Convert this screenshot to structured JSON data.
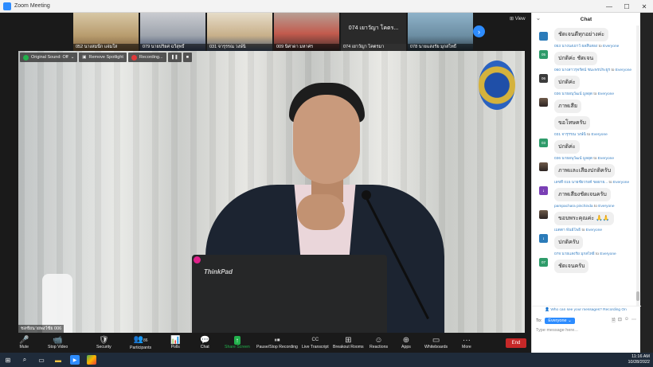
{
  "window": {
    "title": "Zoom Meeting",
    "controls": [
      "—",
      "☐",
      "✕"
    ]
  },
  "gallery": {
    "thumbnails": [
      {
        "name": "052 นางสมนึก แจ่มใส"
      },
      {
        "name": "079 นายปริยศ ฉวีสุทธิ์"
      },
      {
        "name": "031 จารุรรณ วงษ์นิ"
      },
      {
        "name": "009 นิศาดา มหาศร"
      },
      {
        "name": "074 เยาวัญา โคตรมา",
        "big_name": "074 เยาวัญา โคตร..."
      },
      {
        "name": "078 นายแสงรัย มุกสไทธิ์"
      }
    ],
    "view_label": "View"
  },
  "video_toolbar": {
    "original_sound": "Original Sound: Off",
    "remove_spotlight": "Remove Spotlight",
    "recording": "Recording..."
  },
  "main_video": {
    "speaker_label": "ชลชัยนายพงว์ชัย 006",
    "laptop_brand": "ThinkPad"
  },
  "controls": [
    {
      "id": "mute",
      "icon": "🎤",
      "label": "Mute"
    },
    {
      "id": "stop-video",
      "icon": "📹",
      "label": "Stop Video"
    },
    {
      "id": "security",
      "icon": "🛡",
      "label": "Security"
    },
    {
      "id": "participants",
      "icon": "👥",
      "label": "Participants",
      "count": "86"
    },
    {
      "id": "polls",
      "icon": "📊",
      "label": "Polls"
    },
    {
      "id": "chat",
      "icon": "💬",
      "label": "Chat"
    },
    {
      "id": "share-screen",
      "icon": "↑",
      "label": "Share Screen"
    },
    {
      "id": "pause-stop-recording",
      "icon": "⏸⏹",
      "label": "Pause/Stop Recording"
    },
    {
      "id": "live-transcript",
      "icon": "CC",
      "label": "Live Transcript"
    },
    {
      "id": "breakout-rooms",
      "icon": "⊞",
      "label": "Breakout Rooms"
    },
    {
      "id": "reactions",
      "icon": "☺",
      "label": "Reactions"
    },
    {
      "id": "apps",
      "icon": "⊕",
      "label": "Apps"
    },
    {
      "id": "whiteboards",
      "icon": "▭",
      "label": "Whiteboards"
    },
    {
      "id": "more",
      "icon": "···",
      "label": "More"
    }
  ],
  "end_button": "End",
  "chat": {
    "title": "Chat",
    "messages": [
      {
        "sender": "",
        "to": "",
        "dest": "",
        "avatar_text": "",
        "avatar_color": "blue",
        "texts": [
          "ชัดเจนดีทุกอย่างค่ะ"
        ]
      },
      {
        "sender": "053 นางนงเยาว์ ผลสืบสอง",
        "to": "to",
        "dest": "Everyone",
        "avatar_text": "05",
        "avatar_color": "green",
        "texts": [
          "ปกติค่ะ ชัดเจน"
        ]
      },
      {
        "sender": "060 นางสาวรุจรัตน์ ชนะพรประยูร",
        "to": "to",
        "dest": "Everyone",
        "avatar_text": "06",
        "avatar_color": "dark",
        "texts": [
          "ปกติค่ะ"
        ]
      },
      {
        "sender": "036 นายอนุวัฒน์ มูลอุด",
        "to": "to",
        "dest": "Everyone",
        "avatar_text": "",
        "avatar_color": "photo",
        "texts": [
          "ภาพเสีย",
          "ขอโทษครับ"
        ]
      },
      {
        "sender": "031 จารุรรณ วงษ์นิ",
        "to": "to",
        "dest": "Everyone",
        "avatar_text": "03",
        "avatar_color": "green",
        "texts": [
          "ปกติค่ะ"
        ]
      },
      {
        "sender": "036 นายอนุวัฒน์ มูลอุด",
        "to": "to",
        "dest": "Everyone",
        "avatar_text": "",
        "avatar_color": "photo",
        "texts": [
          "ภาพและเสียงปกติครับ"
        ]
      },
      {
        "sender": "เลขที่ 015 นายชัยวรงค์ ขอยาย...",
        "to": "to",
        "dest": "Everyone",
        "avatar_text": "เ",
        "avatar_color": "purple",
        "texts": [
          "ภาพเสียงชัดเจนครับ"
        ]
      },
      {
        "sender": "pampachara pinchinda",
        "to": "to",
        "dest": "Everyone",
        "avatar_text": "",
        "avatar_color": "photo",
        "texts": [
          "ขอบพระคุณค่ะ 🙏🙏"
        ]
      },
      {
        "sender": "เมตตา พันธ์โพธิ์",
        "to": "to",
        "dest": "Everyone",
        "avatar_text": "เ",
        "avatar_color": "blue",
        "texts": [
          "ปกติครับ"
        ]
      },
      {
        "sender": "078 นายแสงรัย มุกสไทธิ์",
        "to": "to",
        "dest": "Everyone",
        "avatar_text": "07",
        "avatar_color": "green",
        "texts": [
          "ชัดเจนครับ"
        ]
      }
    ],
    "who_can_see": "Who can see your messages? Recording On",
    "to_label": "To:",
    "recipient": "Everyone",
    "placeholder": "Type message here..."
  },
  "taskbar": {
    "time": "11:16 AM",
    "date": "10/28/2022"
  },
  "colors": {
    "accent": "#2d8cff",
    "share_green": "#22b14c",
    "end_red": "#c62828"
  }
}
